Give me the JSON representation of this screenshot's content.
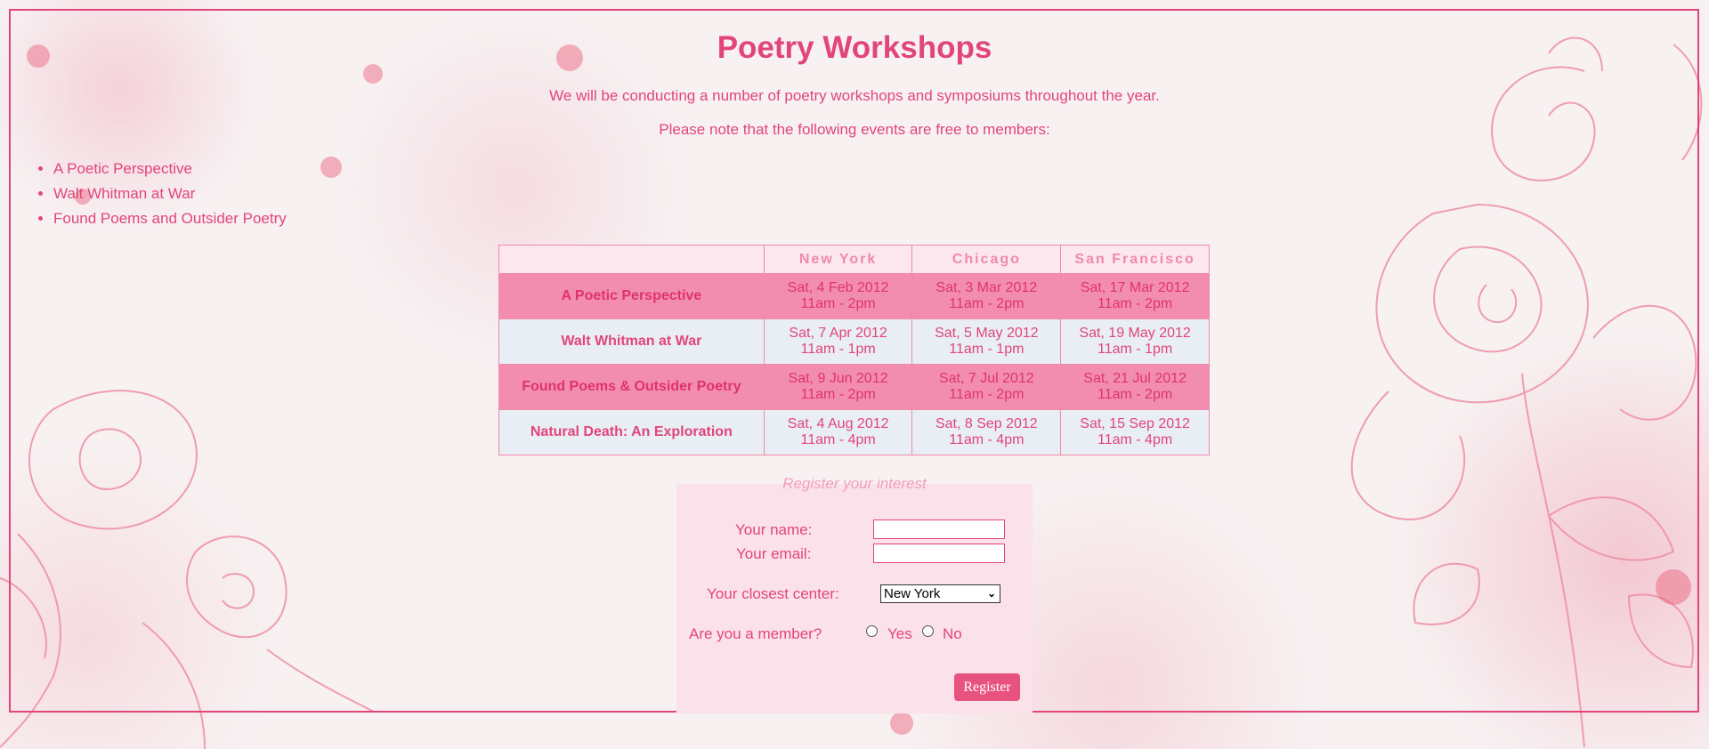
{
  "page": {
    "title": "Poetry Workshops",
    "intro_line1": "We will be conducting a number of poetry workshops and symposiums throughout the year.",
    "intro_line2": "Please note that the following events are free to members:"
  },
  "free_events": [
    "A Poetic Perspective",
    "Walt Whitman at War",
    "Found Poems and Outsider Poetry"
  ],
  "schedule": {
    "headers": [
      "",
      "New York",
      "Chicago",
      "San Francisco"
    ],
    "rows": [
      {
        "event": "A Poetic Perspective",
        "new_york": {
          "date": "Sat, 4 Feb 2012",
          "time": "11am - 2pm"
        },
        "chicago": {
          "date": "Sat, 3 Mar 2012",
          "time": "11am - 2pm"
        },
        "san_francisco": {
          "date": "Sat, 17 Mar 2012",
          "time": "11am - 2pm"
        }
      },
      {
        "event": "Walt Whitman at War",
        "new_york": {
          "date": "Sat, 7 Apr 2012",
          "time": "11am - 1pm"
        },
        "chicago": {
          "date": "Sat, 5 May 2012",
          "time": "11am - 1pm"
        },
        "san_francisco": {
          "date": "Sat, 19 May 2012",
          "time": "11am - 1pm"
        }
      },
      {
        "event": "Found Poems & Outsider Poetry",
        "new_york": {
          "date": "Sat, 9 Jun 2012",
          "time": "11am - 2pm"
        },
        "chicago": {
          "date": "Sat, 7 Jul 2012",
          "time": "11am - 2pm"
        },
        "san_francisco": {
          "date": "Sat, 21 Jul 2012",
          "time": "11am - 2pm"
        }
      },
      {
        "event": "Natural Death: An Exploration",
        "new_york": {
          "date": "Sat, 4 Aug 2012",
          "time": "11am - 4pm"
        },
        "chicago": {
          "date": "Sat, 8 Sep 2012",
          "time": "11am - 4pm"
        },
        "san_francisco": {
          "date": "Sat, 15 Sep 2012",
          "time": "11am - 4pm"
        }
      }
    ]
  },
  "register_form": {
    "legend": "Register your interest",
    "name_label": "Your name:",
    "name_value": "",
    "email_label": "Your email:",
    "email_value": "",
    "center_label": "Your closest center:",
    "center_selected": "New York",
    "member_label": "Are you a member?",
    "member_yes": "Yes",
    "member_no": "No",
    "submit_label": "Register"
  },
  "colors": {
    "accent": "#e2457a",
    "row_pink": "#f28db0",
    "row_light": "#e8eef4",
    "panel": "#fbe1ea",
    "button": "#e8527e"
  }
}
